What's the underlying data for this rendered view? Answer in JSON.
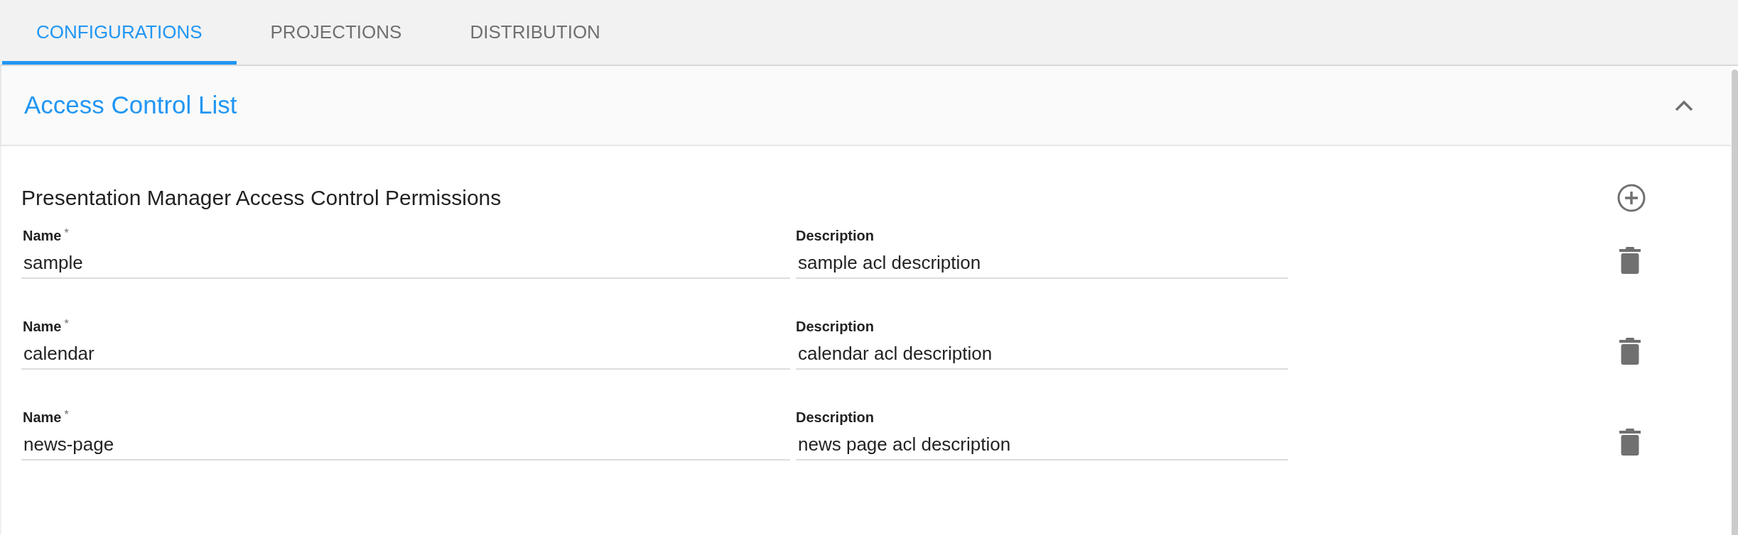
{
  "tabs": [
    {
      "label": "CONFIGURATIONS",
      "selected": true
    },
    {
      "label": "PROJECTIONS",
      "selected": false
    },
    {
      "label": "DISTRIBUTION",
      "selected": false
    }
  ],
  "panel": {
    "title": "Access Control List",
    "expanded": true,
    "section_title": "Presentation Manager Access Control Permissions",
    "rows": [
      {
        "name_label": "Name",
        "name_required_mark": "*",
        "name_value": "sample",
        "description_label": "Description",
        "description_value": "sample acl description"
      },
      {
        "name_label": "Name",
        "name_required_mark": "*",
        "name_value": "calendar",
        "description_label": "Description",
        "description_value": "calendar acl description"
      },
      {
        "name_label": "Name",
        "name_required_mark": "*",
        "name_value": "news-page",
        "description_label": "Description",
        "description_value": "news page acl description"
      }
    ]
  }
}
